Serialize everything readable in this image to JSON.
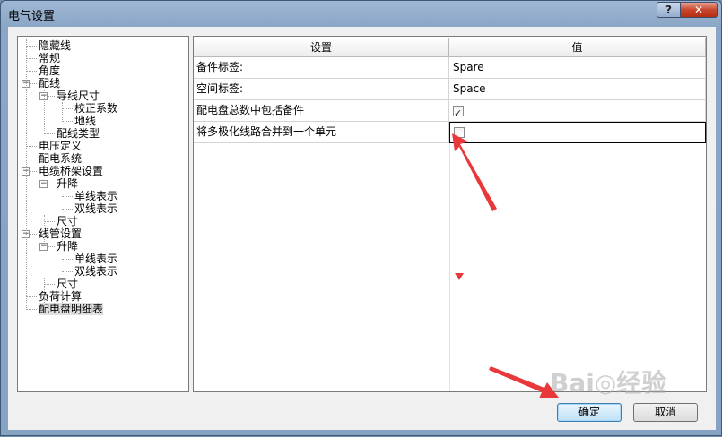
{
  "window": {
    "title": "电气设置",
    "help_label": "?",
    "close_label": "✕"
  },
  "tree": {
    "items": [
      {
        "label": "隐藏线",
        "level": 0
      },
      {
        "label": "常规",
        "level": 0
      },
      {
        "label": "角度",
        "level": 0
      },
      {
        "label": "配线",
        "level": 0,
        "toggle": "−"
      },
      {
        "label": "导线尺寸",
        "level": 1,
        "toggle": "−"
      },
      {
        "label": "校正系数",
        "level": 2
      },
      {
        "label": "地线",
        "level": 2
      },
      {
        "label": "配线类型",
        "level": 1
      },
      {
        "label": "电压定义",
        "level": 0
      },
      {
        "label": "配电系统",
        "level": 0
      },
      {
        "label": "电缆桥架设置",
        "level": 0,
        "toggle": "−"
      },
      {
        "label": "升降",
        "level": 1,
        "toggle": "−"
      },
      {
        "label": "单线表示",
        "level": 2
      },
      {
        "label": "双线表示",
        "level": 2
      },
      {
        "label": "尺寸",
        "level": 1
      },
      {
        "label": "线管设置",
        "level": 0,
        "toggle": "−"
      },
      {
        "label": "升降",
        "level": 1,
        "toggle": "−"
      },
      {
        "label": "单线表示",
        "level": 2
      },
      {
        "label": "双线表示",
        "level": 2
      },
      {
        "label": "尺寸",
        "level": 1
      },
      {
        "label": "负荷计算",
        "level": 0
      },
      {
        "label": "配电盘明细表",
        "level": 0,
        "selected": true
      }
    ]
  },
  "grid": {
    "headers": {
      "setting": "设置",
      "value": "值"
    },
    "rows": [
      {
        "setting": "备件标签:",
        "value": "Spare"
      },
      {
        "setting": "空间标签:",
        "value": "Space"
      },
      {
        "setting": "配电盘总数中包括备件",
        "checked": true
      },
      {
        "setting": "将多极化线路合并到一个单元",
        "checked": false
      }
    ]
  },
  "buttons": {
    "ok": "确定",
    "cancel": "取消"
  },
  "watermark": "Bai◎经验",
  "colors": {
    "annotation_arrow": "#e8383a",
    "focus": "#000000"
  }
}
